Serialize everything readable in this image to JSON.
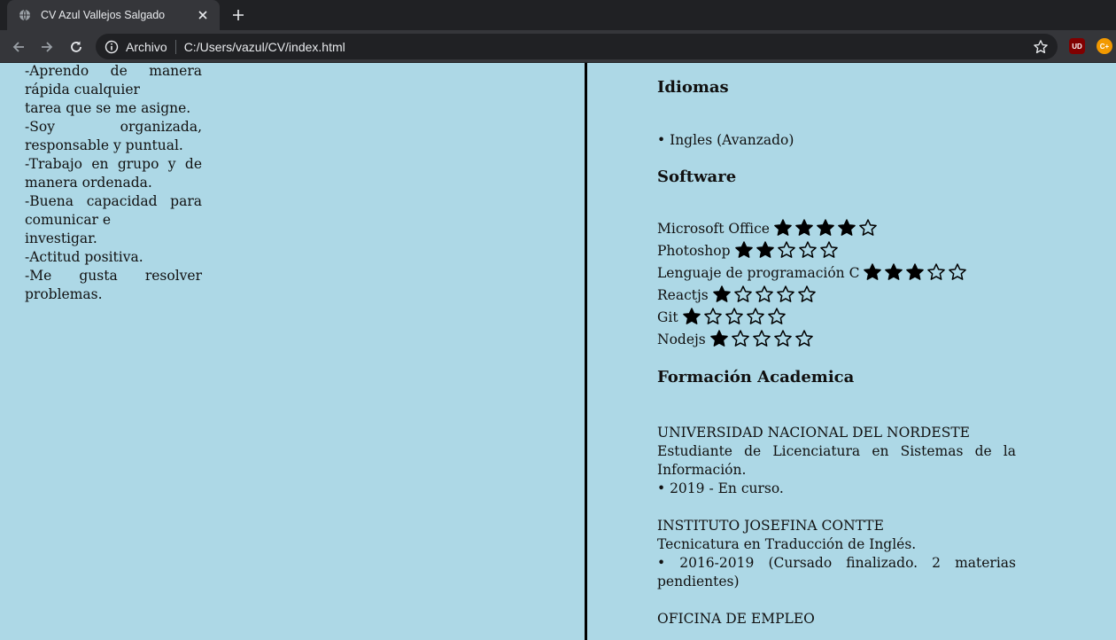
{
  "browser": {
    "tab_title": "CV Azul Vallejos Salgado",
    "omnibox_chip": "Archivo",
    "url": "C:/Users/vazul/CV/index.html",
    "ext1_label": "UD",
    "ext2_label": "C+"
  },
  "left": {
    "lines": [
      "-Aprendo de manera rápida cualquier",
      "tarea que se me asigne.",
      "-Soy organizada, responsable y puntual.",
      "-Trabajo en grupo y de manera ordenada.",
      "-Buena capacidad para comunicar e",
      "investigar.",
      "-Actitud positiva.",
      "-Me gusta resolver problemas."
    ]
  },
  "right": {
    "idiomas_title": "Idiomas",
    "idiomas_item": "• Ingles (Avanzado)",
    "software_title": "Software",
    "software": [
      {
        "name": "Microsoft Office",
        "rating": 4
      },
      {
        "name": "Photoshop",
        "rating": 2
      },
      {
        "name": "Lenguaje de programación C",
        "rating": 3
      },
      {
        "name": "Reactjs",
        "rating": 1
      },
      {
        "name": "Git",
        "rating": 1
      },
      {
        "name": "Nodejs",
        "rating": 1
      }
    ],
    "formacion_title": "Formación Academica",
    "education": [
      {
        "institution": "UNIVERSIDAD NACIONAL DEL NORDESTE",
        "degree": "Estudiante de Licenciatura en Sistemas de la Información.",
        "period": "• 2019 - En curso."
      },
      {
        "institution": "INSTITUTO JOSEFINA CONTTE",
        "degree": "Tecnicatura en Traducción de Inglés.",
        "period": "• 2016-2019 (Cursado finalizado. 2 materias pendientes)"
      },
      {
        "institution": "OFICINA DE EMPLEO",
        "degree": "",
        "period": ""
      }
    ]
  },
  "colors": {
    "page_bg": "#add8e6",
    "chrome_dark": "#202124",
    "chrome_mid": "#35363a",
    "star": "#000000"
  }
}
